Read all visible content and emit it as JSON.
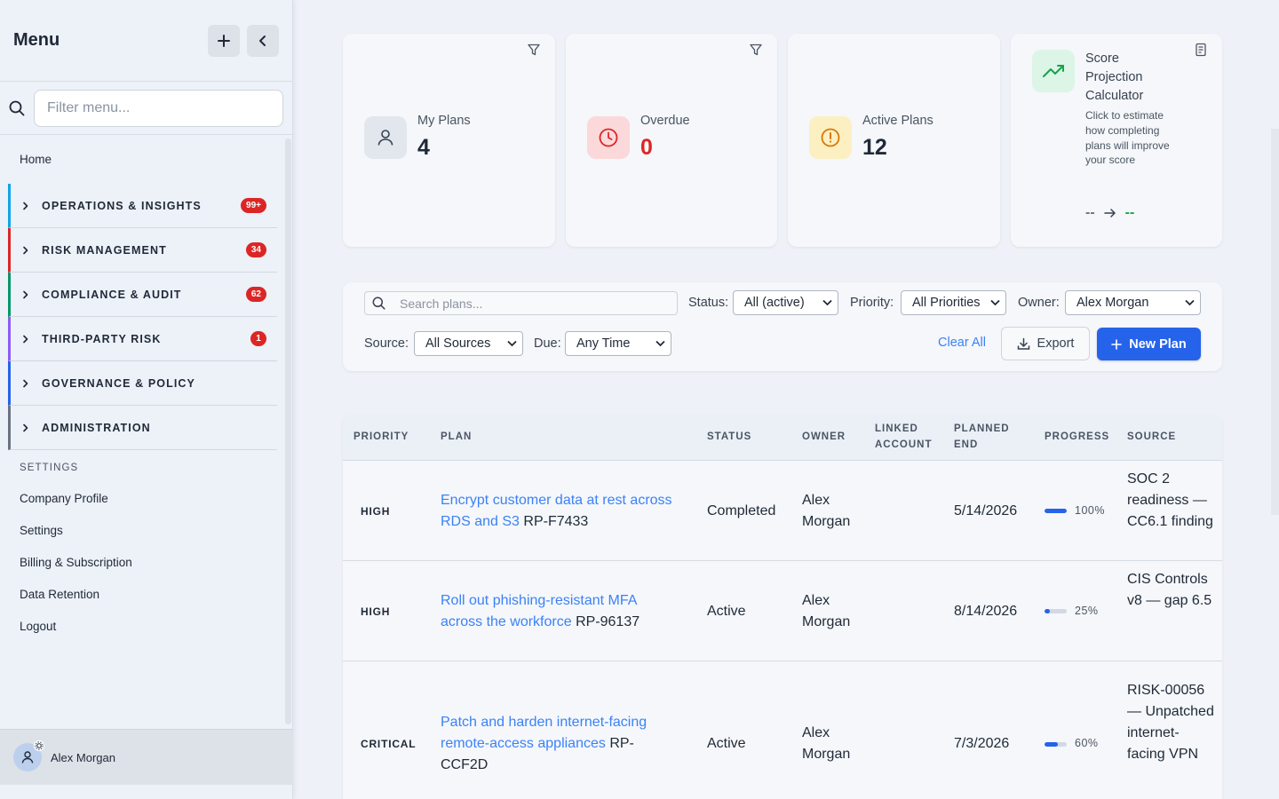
{
  "sidebar": {
    "title": "Menu",
    "filter_placeholder": "Filter menu...",
    "home": "Home",
    "groups": [
      {
        "label": "OPERATIONS & INSIGHTS",
        "badge": "99+",
        "color": "#0ea5e9"
      },
      {
        "label": "RISK MANAGEMENT",
        "badge": "34",
        "color": "#dc2626"
      },
      {
        "label": "COMPLIANCE & AUDIT",
        "badge": "62",
        "color": "#059669"
      },
      {
        "label": "THIRD-PARTY RISK",
        "badge": "1",
        "color": "#8b5cf6"
      },
      {
        "label": "GOVERNANCE & POLICY",
        "badge": "",
        "color": "#2563eb"
      },
      {
        "label": "ADMINISTRATION",
        "badge": "",
        "color": "#6b7280"
      }
    ],
    "settings_heading": "SETTINGS",
    "settings_links": [
      "Company Profile",
      "Settings",
      "Billing & Subscription",
      "Data Retention",
      "Logout"
    ],
    "user_name": "Alex Morgan"
  },
  "stats": [
    {
      "label": "My Plans",
      "value": "4",
      "icon": "user-icon",
      "color": "#1f2937"
    },
    {
      "label": "Overdue",
      "value": "0",
      "icon": "clock-icon",
      "color": "#dc2626"
    },
    {
      "label": "Active Plans",
      "value": "12",
      "icon": "alert-circle-icon",
      "color": "#1f2937"
    }
  ],
  "calculator": {
    "title": "Score Projection Calculator",
    "description": "Click to estimate how completing plans will improve your score",
    "current": "--",
    "projected": "--"
  },
  "toolbar": {
    "search_placeholder": "Search plans...",
    "status_label": "Status:",
    "status_value": "All (active)",
    "priority_label": "Priority:",
    "priority_value": "All Priorities",
    "owner_label": "Owner:",
    "owner_value": "Alex Morgan",
    "source_label": "Source:",
    "source_value": "All Sources",
    "due_label": "Due:",
    "due_value": "Any Time",
    "clear_label": "Clear All",
    "export_label": "Export",
    "new_plan_label": "New Plan"
  },
  "table": {
    "columns": {
      "priority": "PRIORITY",
      "plan": "PLAN",
      "status": "STATUS",
      "owner": "OWNER",
      "linked_account": "LINKED ACCOUNT",
      "planned_end": "PLANNED END",
      "progress": "PROGRESS",
      "source": "SOURCE"
    },
    "rows": [
      {
        "priority": "HIGH",
        "plan": "Encrypt customer data at rest across RDS and S3",
        "plan_id": "RP-F7433",
        "status": "Completed",
        "owner": "Alex Morgan",
        "linked_account": "",
        "planned_end": "5/14/2026",
        "progress": 100,
        "progress_label": "100%",
        "source": "SOC 2 readiness — CC6.1 finding"
      },
      {
        "priority": "HIGH",
        "plan": "Roll out phishing-resistant MFA across the workforce",
        "plan_id": "RP-96137",
        "status": "Active",
        "owner": "Alex Morgan",
        "linked_account": "",
        "planned_end": "8/14/2026",
        "progress": 25,
        "progress_label": "25%",
        "source": "CIS Controls v8 — gap 6.5"
      },
      {
        "priority": "CRITICAL",
        "plan": "Patch and harden internet-facing remote-access appliances",
        "plan_id": "RP-CCF2D",
        "status": "Active",
        "owner": "Alex Morgan",
        "linked_account": "",
        "planned_end": "7/3/2026",
        "progress": 60,
        "progress_label": "60%",
        "source": "RISK-00056 — Unpatched internet-facing VPN"
      }
    ]
  }
}
